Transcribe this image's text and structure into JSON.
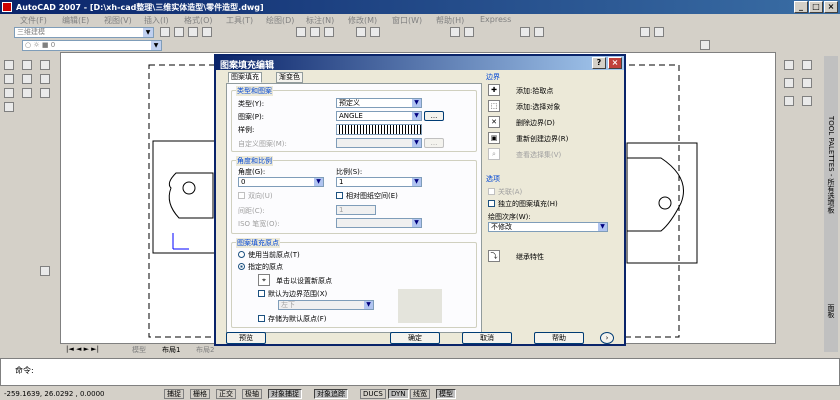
{
  "window": {
    "title": "AutoCAD 2007 - [D:\\xh-cad整理\\三维实体造型\\零件造型.dwg]"
  },
  "menubar": [
    "文件(F)",
    "编辑(E)",
    "视图(V)",
    "插入(I)",
    "格式(O)",
    "工具(T)",
    "绘图(D)",
    "标注(N)",
    "修改(M)",
    "窗口(W)",
    "帮助(H)",
    "Express"
  ],
  "toolbar": {
    "workspace": "三维建模",
    "layer": "0"
  },
  "layout_tabs": [
    "模型",
    "布局1",
    "布局2"
  ],
  "dialog": {
    "title": "图案填充编辑",
    "tabs": [
      "图案填充",
      "渐变色"
    ],
    "type_pattern": {
      "title": "类型和图案",
      "type_label": "类型(Y):",
      "type_value": "预定义",
      "pattern_label": "图案(P):",
      "pattern_value": "ANGLE",
      "swatch_label": "样例:",
      "custom_label": "自定义图案(M):",
      "ellipsis": "..."
    },
    "angle_scale": {
      "title": "角度和比例",
      "angle_label": "角度(G):",
      "angle_value": "0",
      "scale_label": "比例(S):",
      "scale_value": "1",
      "double_label": "双向(U)",
      "relative_label": "相对图纸空间(E)",
      "spacing_label": "间距(C):",
      "spacing_value": "1",
      "iso_label": "ISO 笔宽(O):"
    },
    "origin": {
      "title": "图案填充原点",
      "use_current": "使用当前原点(T)",
      "specified": "指定的原点",
      "click_set": "单击以设置新原点",
      "default_boundary": "默认为边界范围(X)",
      "position_value": "左下",
      "store_default": "存储为默认原点(F)"
    },
    "boundary": {
      "title": "边界",
      "add_pick": "添加:拾取点",
      "add_select": "添加:选择对象",
      "remove": "删除边界(D)",
      "recreate": "重新创建边界(R)",
      "view": "查看选择集(V)"
    },
    "options": {
      "title": "选项",
      "associative": "关联(A)",
      "separate": "独立的图案填充(H)",
      "draw_order_label": "绘图次序(W):",
      "draw_order_value": "不修改"
    },
    "inherit": "继承特性",
    "buttons": {
      "preview": "预览",
      "ok": "确定",
      "cancel": "取消",
      "help": "帮助"
    }
  },
  "palette": {
    "title": "TOOL PALETTES - 所有选项板",
    "side": "面板"
  },
  "command": {
    "prompt": "命令:"
  },
  "status": {
    "coords": "-259.1639, 26.0292 , 0.0000",
    "buttons": [
      "捕捉",
      "栅格",
      "正交",
      "极轴",
      "对象捕捉",
      "对象追踪",
      "DUCS",
      "DYN",
      "线宽",
      "模型"
    ]
  }
}
